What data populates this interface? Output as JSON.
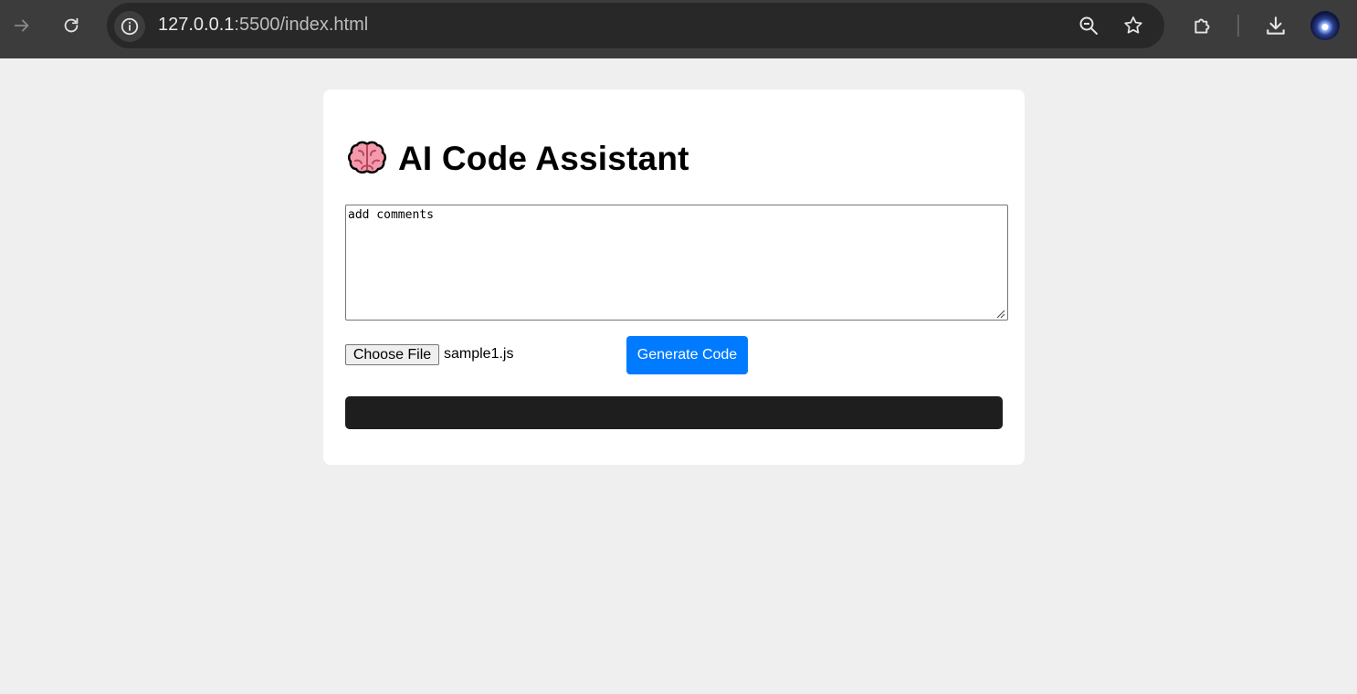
{
  "browser": {
    "url_host": "127.0.0.1",
    "url_rest": ":5500/index.html"
  },
  "page": {
    "title": "AI Code Assistant",
    "title_icon": "brain-icon",
    "prompt_value": "add comments",
    "file_button_label": "Choose File",
    "file_name": "sample1.js",
    "generate_label": "Generate Code",
    "output_text": ""
  },
  "colors": {
    "accent": "#007bff",
    "output_bg": "#1e1e1e",
    "page_bg": "#efefef",
    "chrome_bg": "#3c3c3c"
  }
}
